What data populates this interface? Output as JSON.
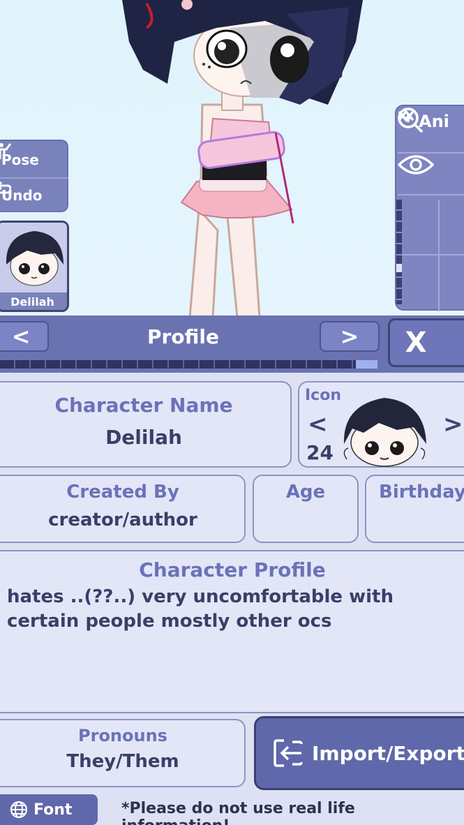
{
  "scene": {
    "character_label": "Delilah"
  },
  "side_controls": {
    "pose_label": "Pose",
    "undo_label": "Undo"
  },
  "view_controls": {
    "ani_label": "Ani"
  },
  "header": {
    "title": "Profile",
    "prev_label": "<",
    "next_label": ">",
    "close_label": "X"
  },
  "form": {
    "character_name": {
      "label": "Character Name",
      "value": "Delilah"
    },
    "icon": {
      "label": "Icon",
      "number": "24",
      "prev": "<",
      "next": ">"
    },
    "created_by": {
      "label": "Created By",
      "value": "creator/author"
    },
    "age": {
      "label": "Age",
      "value": ""
    },
    "birthday": {
      "label": "Birthday",
      "value": ""
    },
    "profile": {
      "label": "Character Profile",
      "value": "hates ..(??..) very uncomfortable with certain people mostly other ocs"
    },
    "pronouns": {
      "label": "Pronouns",
      "value": "They/Them"
    },
    "import_export_label": "Import/Export"
  },
  "footer": {
    "font_label": "Font",
    "note": "*Please do not use real life information!"
  }
}
